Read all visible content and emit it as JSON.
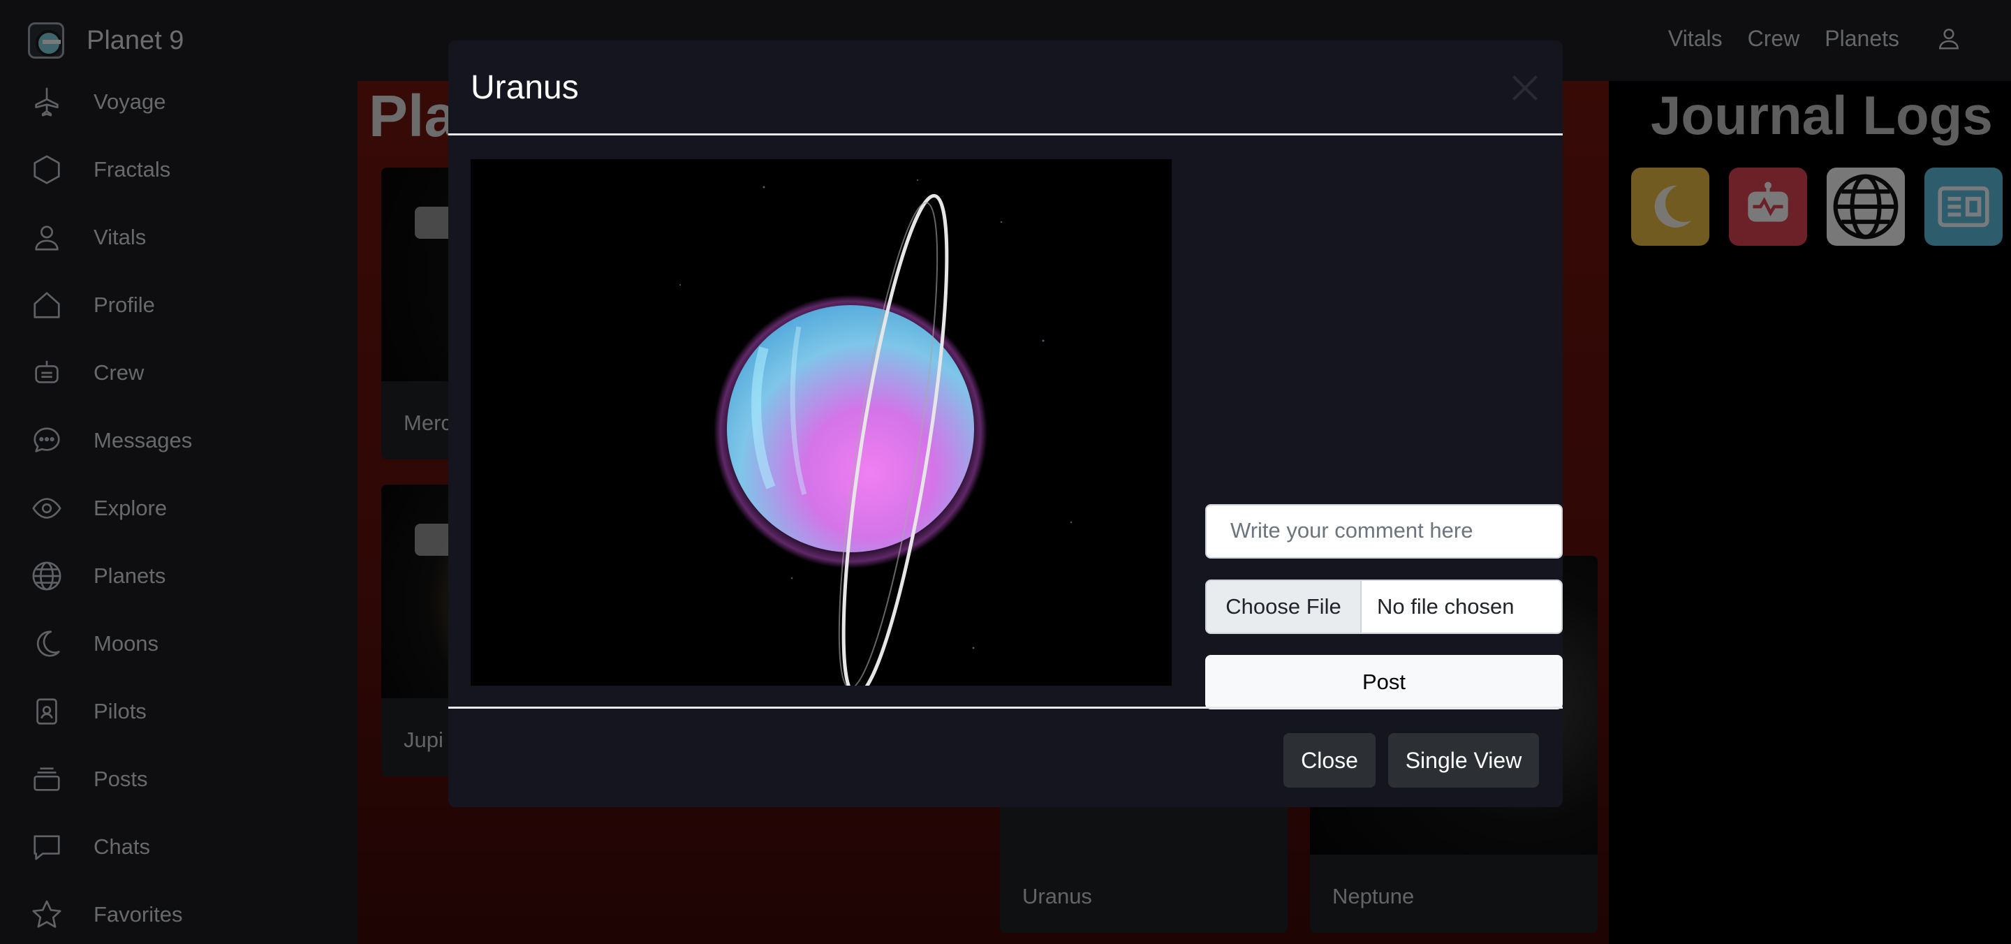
{
  "brand": {
    "name": "Planet 9",
    "logo_icon": "planet-logo-icon"
  },
  "topnav": {
    "items": [
      "Vitals",
      "Crew",
      "Planets"
    ],
    "user_icon": "user-icon"
  },
  "sidebar": {
    "items": [
      {
        "label": "Voyage",
        "icon": "airplane-icon"
      },
      {
        "label": "Fractals",
        "icon": "hexagon-icon"
      },
      {
        "label": "Vitals",
        "icon": "person-icon"
      },
      {
        "label": "Profile",
        "icon": "house-icon"
      },
      {
        "label": "Crew",
        "icon": "robot-icon"
      },
      {
        "label": "Messages",
        "icon": "chat-dots-icon"
      },
      {
        "label": "Explore",
        "icon": "eye-icon"
      },
      {
        "label": "Planets",
        "icon": "globe-icon"
      },
      {
        "label": "Moons",
        "icon": "moon-icon"
      },
      {
        "label": "Pilots",
        "icon": "id-badge-icon"
      },
      {
        "label": "Posts",
        "icon": "stack-icon"
      },
      {
        "label": "Chats",
        "icon": "chat-square-icon"
      },
      {
        "label": "Favorites",
        "icon": "star-icon"
      }
    ]
  },
  "main": {
    "title": "Pla",
    "cards": [
      {
        "label": "Merc"
      },
      {
        "label": "Jupi"
      },
      {
        "label": "Uranus"
      },
      {
        "label": "Neptune"
      }
    ]
  },
  "right_panel": {
    "title": "Journal Logs",
    "icons": [
      "moon-app-icon",
      "robot-app-icon",
      "globe-app-icon",
      "newspaper-app-icon"
    ]
  },
  "modal": {
    "title": "Uranus",
    "close_icon": "close-icon",
    "image_alt": "Uranus",
    "comment_placeholder": "Write your comment here",
    "file_button": "Choose File",
    "file_status": "No file chosen",
    "post_label": "Post",
    "footer": {
      "close_label": "Close",
      "single_view_label": "Single View"
    }
  },
  "colors": {
    "modal_bg": "#15151f",
    "main_bg": "#6e140d",
    "accent_dark": "#2c2f33"
  }
}
